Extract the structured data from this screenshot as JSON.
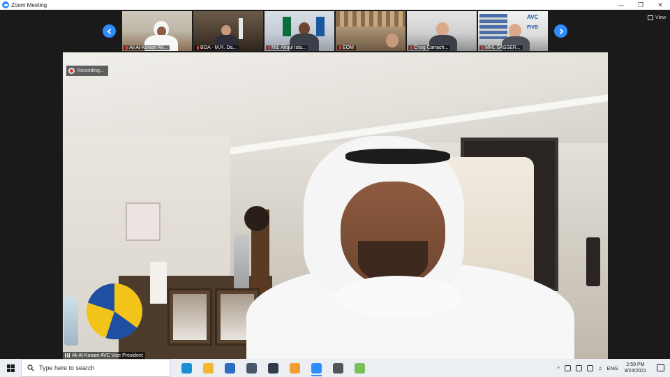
{
  "window": {
    "title": "Zoom Meeting",
    "controls": [
      "minimize",
      "restore",
      "close"
    ]
  },
  "meeting": {
    "view_label": "View",
    "recording_label": "Recording...",
    "active_speaker": "Ali Al-Kuwari AVC Vice President",
    "participants": [
      {
        "name": "Ali Al-Kuwari AV..."
      },
      {
        "name": "BOA - M.R. Da..."
      },
      {
        "name": "Md. Atiqul Isla..."
      },
      {
        "name": "EOM"
      },
      {
        "name": "Craig Carrach..."
      },
      {
        "name": "MHL SASSER..."
      }
    ]
  },
  "taskbar": {
    "search_placeholder": "Type here to search",
    "apps": [
      {
        "icon": "edge-icon",
        "color": "#1b8fd4",
        "active": false
      },
      {
        "icon": "file-explorer-icon",
        "color": "#f2b632",
        "active": false
      },
      {
        "icon": "mail-icon",
        "color": "#2b6cc4",
        "active": false
      },
      {
        "icon": "vivaldi-icon",
        "color": "#4a5568",
        "active": false
      },
      {
        "icon": "vivaldi-icon",
        "color": "#2f3a4a",
        "active": false
      },
      {
        "icon": "orange-app-icon",
        "color": "#f39c32",
        "active": false
      },
      {
        "icon": "zoom-icon",
        "color": "#2d8cff",
        "active": true
      },
      {
        "icon": "settings-icon",
        "color": "#555555",
        "active": false
      },
      {
        "icon": "feather-app-icon",
        "color": "#7bbf5a",
        "active": false
      }
    ],
    "tray": {
      "language": "ENG",
      "time": "2:59 PM",
      "date": "8/24/2021"
    }
  },
  "colors": {
    "zoom_blue": "#2d8cff",
    "stage_bg": "#1a1a1a",
    "taskbar_bg": "#ebeef3"
  }
}
